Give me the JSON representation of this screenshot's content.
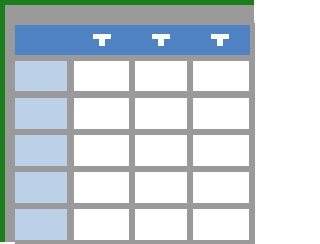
{
  "table_icon": {
    "header_columns": 3,
    "rows": 5,
    "colors": {
      "frame_border": "#1a7f1a",
      "grid_lines": "#9a9a9a",
      "header_fill": "#4f82c3",
      "row_header_fill": "#bcd0e8",
      "cell_fill": "#ffffff",
      "filter_glyph": "#ffffff"
    },
    "icons": [
      "filter-icon",
      "filter-icon",
      "filter-icon"
    ]
  }
}
